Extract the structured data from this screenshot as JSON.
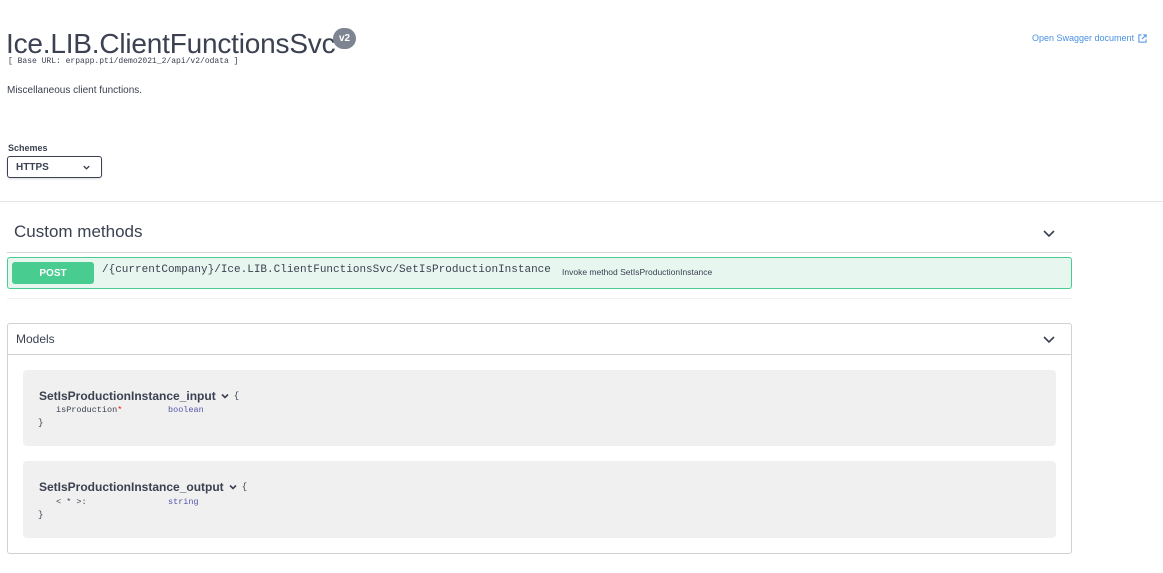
{
  "header": {
    "title": "Ice.LIB.ClientFunctionsSvc",
    "version": "v2",
    "base_url": "[ Base URL: erpapp.pti/demo2021_2/api/v2/odata ]",
    "description": "Miscellaneous client functions.",
    "open_swagger_label": "Open Swagger document",
    "link_color": "#4990e2"
  },
  "schemes": {
    "label": "Schemes",
    "selected": "HTTPS"
  },
  "custom_methods": {
    "title": "Custom methods",
    "operations": [
      {
        "method": "POST",
        "path": "/{currentCompany}/Ice.LIB.ClientFunctionsSvc/SetIsProductionInstance",
        "summary": "Invoke method SetIsProductionInstance",
        "method_color": "#49cc90"
      }
    ]
  },
  "models": {
    "title": "Models",
    "items": [
      {
        "name": "SetIsProductionInstance_input",
        "open_brace": "{",
        "close_brace": "}",
        "property": "isProduction",
        "required_mark": "*",
        "type": "boolean"
      },
      {
        "name": "SetIsProductionInstance_output",
        "open_brace": "{",
        "close_brace": "}",
        "property": "< * >:",
        "required_mark": "",
        "type": "string"
      }
    ]
  },
  "icons": {
    "external_link": "external-link-icon",
    "chevron": "chevron-down-icon"
  }
}
